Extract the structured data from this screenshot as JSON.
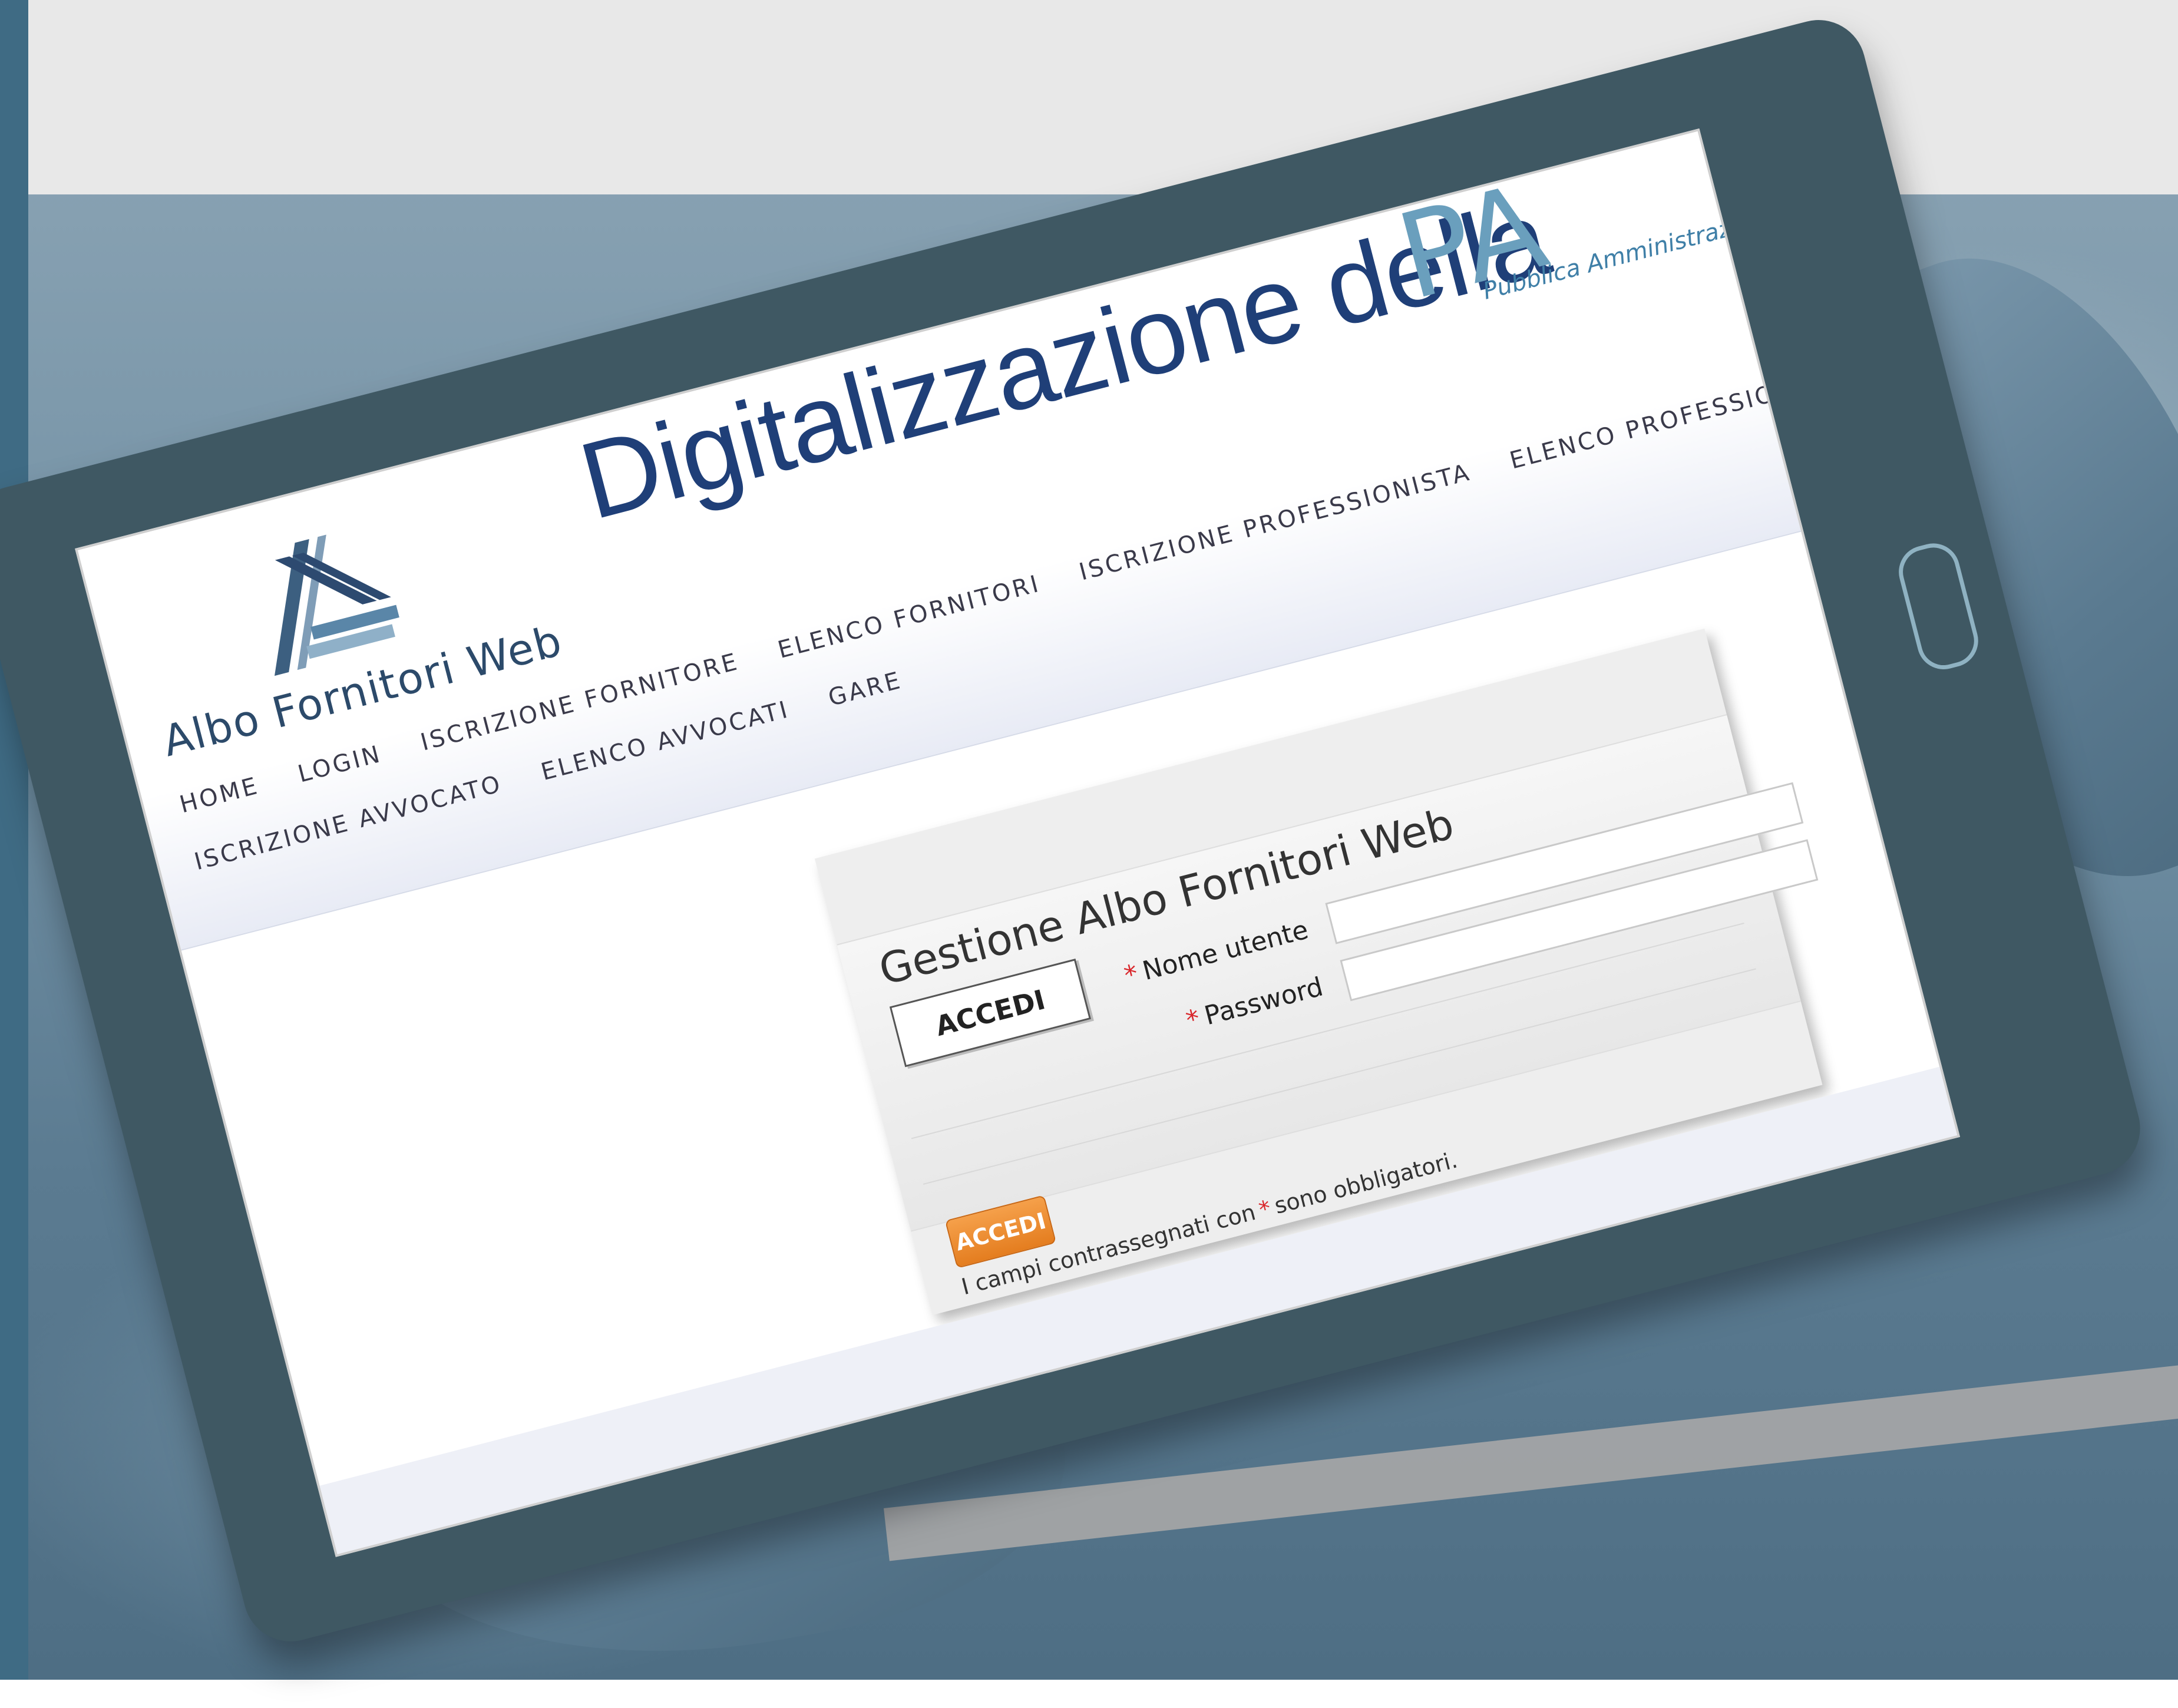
{
  "banner": {
    "title": "Digitalizzazione della",
    "pa_letters": "PA",
    "pa_subtitle": "Pubblica Amministrazione"
  },
  "logo": {
    "text": "Albo Fornitori Web"
  },
  "nav": {
    "row1": [
      "HOME",
      "LOGIN",
      "ISCRIZIONE FORNITORE",
      "ELENCO FORNITORI",
      "ISCRIZIONE PROFESSIONISTA",
      "ELENCO PROFESSIONISTI"
    ],
    "row2": [
      "ISCRIZIONE AVVOCATO",
      "ELENCO AVVOCATI",
      "GARE"
    ]
  },
  "login": {
    "title": "Gestione Albo Fornitori Web",
    "tab_label": "ACCEDI",
    "username_label": "Nome utente",
    "password_label": "Password",
    "required_marker": "*",
    "submit_label": "ACCEDI",
    "footnote_before": "I campi contrassegnati con",
    "footnote_after": "sono obbligatori."
  },
  "colors": {
    "banner_blue": "#1f3f78",
    "pa_blue": "#6a9fbd",
    "tablet_frame": "#3f5863",
    "submit_orange": "#e47d1f",
    "required_red": "#d9262b"
  }
}
